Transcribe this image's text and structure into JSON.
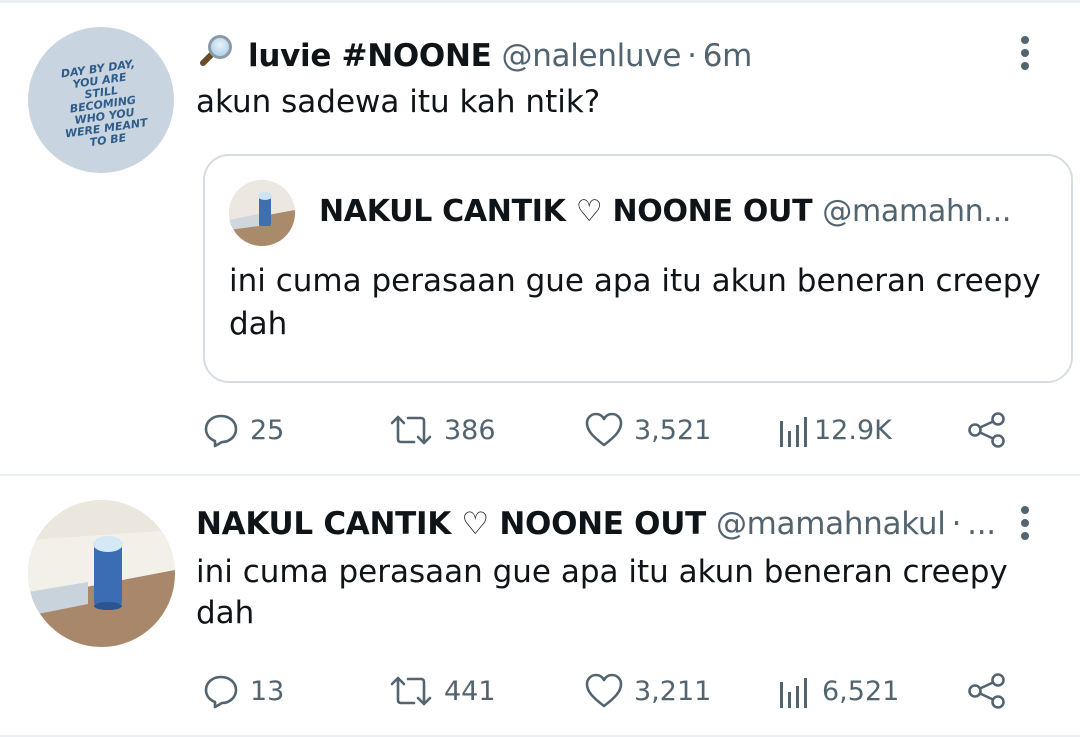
{
  "tweets": [
    {
      "display_name": "luvie #NOONE",
      "handle": "@nalenluve",
      "separator": "·",
      "time": "6m",
      "text": "akun sadewa itu kah ntik?",
      "avatar_text": [
        "DAY BY DAY,",
        "YOU ARE",
        "STILL BECOMING",
        "WHO YOU",
        "WERE MEANT",
        "TO BE"
      ],
      "quote": {
        "display_name": "NAKUL CANTIK ♡ NOONE OUT",
        "handle": "@mamahn...",
        "text": "ini cuma perasaan gue apa itu akun beneran creepy dah"
      },
      "stats": {
        "replies": "25",
        "retweets": "386",
        "likes": "3,521",
        "views": "12.9K"
      }
    },
    {
      "display_name": "NAKUL CANTIK ♡ NOONE OUT",
      "handle": "@mamahnakul",
      "separator": "·",
      "time": "...",
      "text": "ini cuma perasaan gue apa itu akun beneran creepy dah",
      "stats": {
        "replies": "13",
        "retweets": "441",
        "likes": "3,211",
        "views": "6,521"
      }
    }
  ],
  "icons": {
    "search": "magnifying-glass-icon",
    "more": "more-vertical-icon",
    "reply": "reply-icon",
    "retweet": "retweet-icon",
    "like": "heart-icon",
    "views": "views-icon",
    "share": "share-icon"
  },
  "colors": {
    "text_primary": "#0f1419",
    "text_secondary": "#536471",
    "border": "#d6dde2"
  }
}
